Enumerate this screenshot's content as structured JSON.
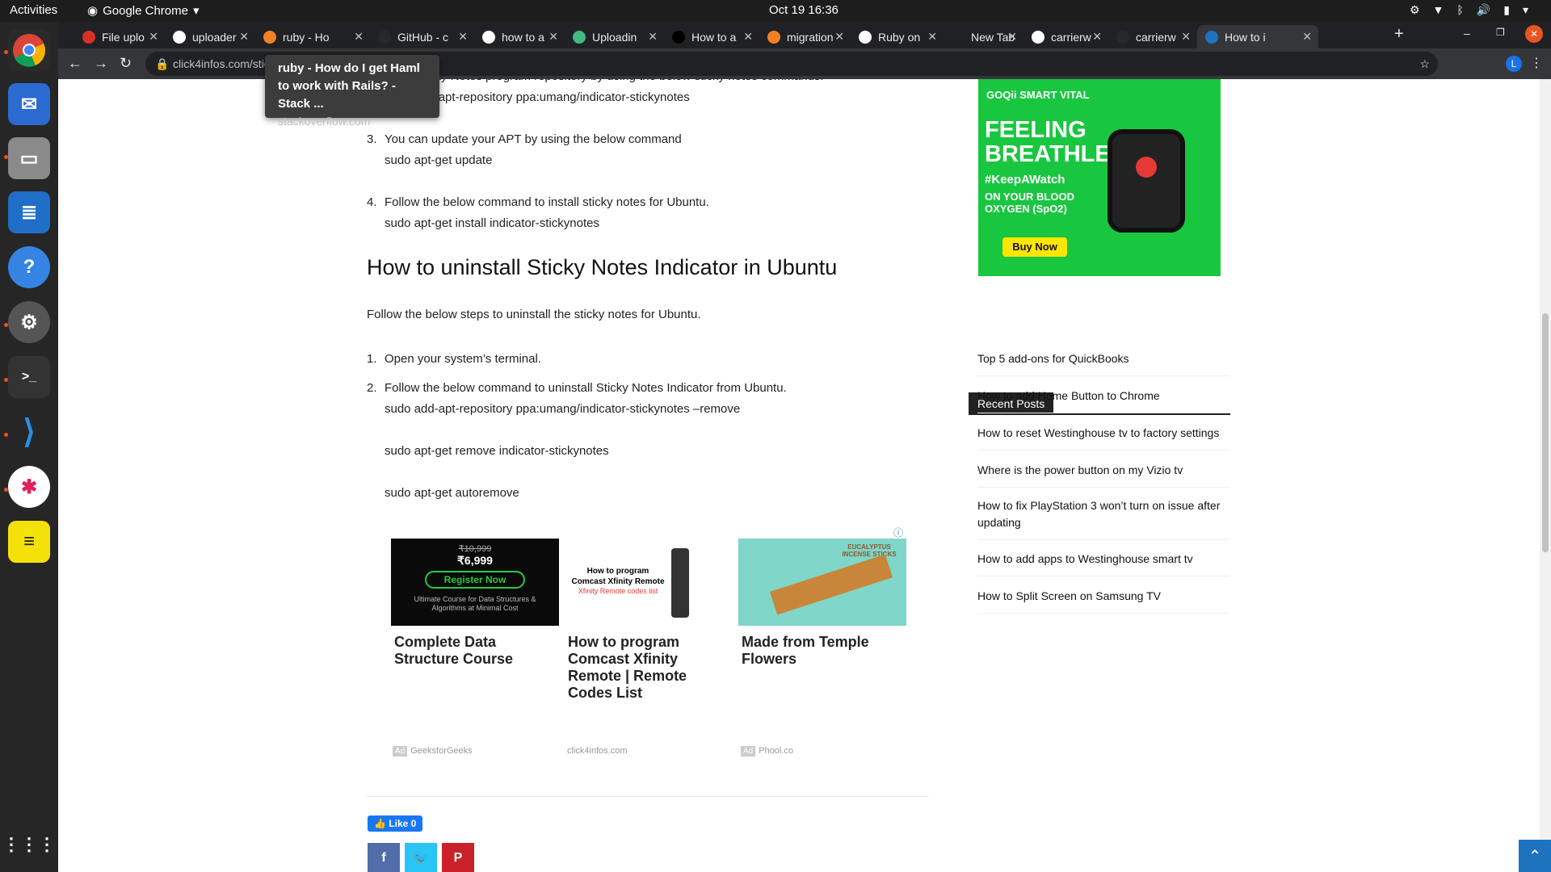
{
  "system": {
    "activities": "Activities",
    "app_name": "Google Chrome",
    "clock": "Oct 19  16:36"
  },
  "browser": {
    "tabs": [
      {
        "title": "File uplo",
        "fav": "#d93025"
      },
      {
        "title": "uploader",
        "fav": "#ffffff"
      },
      {
        "title": "ruby - Ho",
        "fav": "#f48024"
      },
      {
        "title": "GitHub - c",
        "fav": "#24292e"
      },
      {
        "title": "how to a",
        "fav": "#ffffff"
      },
      {
        "title": "Uploadin",
        "fav": "#42b983"
      },
      {
        "title": "How to a",
        "fav": "#000000"
      },
      {
        "title": "migration",
        "fav": "#f48024"
      },
      {
        "title": "Ruby on",
        "fav": "#ffffff"
      },
      {
        "title": "New Tab",
        "fav": ""
      },
      {
        "title": "carrierw",
        "fav": "#ffffff"
      },
      {
        "title": "carrierw",
        "fav": "#24292e"
      },
      {
        "title": "How to i",
        "fav": "#1e73be"
      }
    ],
    "url": "click4infos.com/stic",
    "tooltip_title": "ruby - How do I get Haml to work with Rails? - Stack ...",
    "tooltip_url": "stackoverflow.com",
    "profile": "L"
  },
  "article": {
    "partial_top": "d the Sticky Notes program repository by using the below sticky notes commands.",
    "step2_cmd": "sudo add-apt-repository ppa:umang/indicator-stickynotes",
    "step3": "You can update your APT by using the below command",
    "step3_cmd": "sudo apt-get update",
    "step4": "Follow the below command to install sticky notes for Ubuntu.",
    "step4_cmd": "sudo apt-get install indicator-stickynotes",
    "heading": "How to uninstall Sticky Notes Indicator in Ubuntu",
    "intro": "Follow the below steps to uninstall the sticky notes for Ubuntu.",
    "u1": "Open your system’s terminal.",
    "u2": "Follow the below command to uninstall Sticky Notes Indicator from Ubuntu.",
    "u2_cmd1": "sudo add-apt-repository ppa:umang/indicator-stickynotes –remove",
    "u2_cmd2": "sudo apt-get remove indicator-stickynotes",
    "u2_cmd3": "sudo apt-get autoremove"
  },
  "ads": [
    {
      "caption": "Complete Data Structure Course",
      "source": "GeeksforGeeks",
      "price_old": "₹10,999",
      "price": "₹6,999",
      "cta": "Register Now",
      "tagline": "Ultimate Course for Data Structures & Algorithms at Minimal Cost"
    },
    {
      "caption": "How to program Comcast Xfinity Remote | Remote Codes List",
      "source": "click4infos.com",
      "img_text": "How to program Comcast Xfinity Remote",
      "img_sub": "Xfinity Remote codes list"
    },
    {
      "caption": "Made from Temple Flowers",
      "source": "Phool.co",
      "img_text": "EUCALYPTUS INCENSE STICKS"
    }
  ],
  "social": {
    "like": "Like 0"
  },
  "sidebar": {
    "ad": {
      "brand": "GOQii SMART VITAL",
      "headline": "FEELING BREATHLESS?",
      "hashtag": "#KeepAWatch",
      "sub": "ON YOUR BLOOD OXYGEN (SpO2)",
      "cta": "Buy Now"
    },
    "recent_title": "Recent Posts",
    "recent": [
      "Top 5 add-ons for QuickBooks",
      "How to add Home Button to Chrome",
      "How to reset Westinghouse tv to factory settings",
      "Where is the power button on my Vizio tv",
      "How to fix PlayStation 3 won’t turn on issue after updating",
      "How to add apps to Westinghouse smart tv",
      "How to Split Screen on Samsung TV"
    ]
  }
}
